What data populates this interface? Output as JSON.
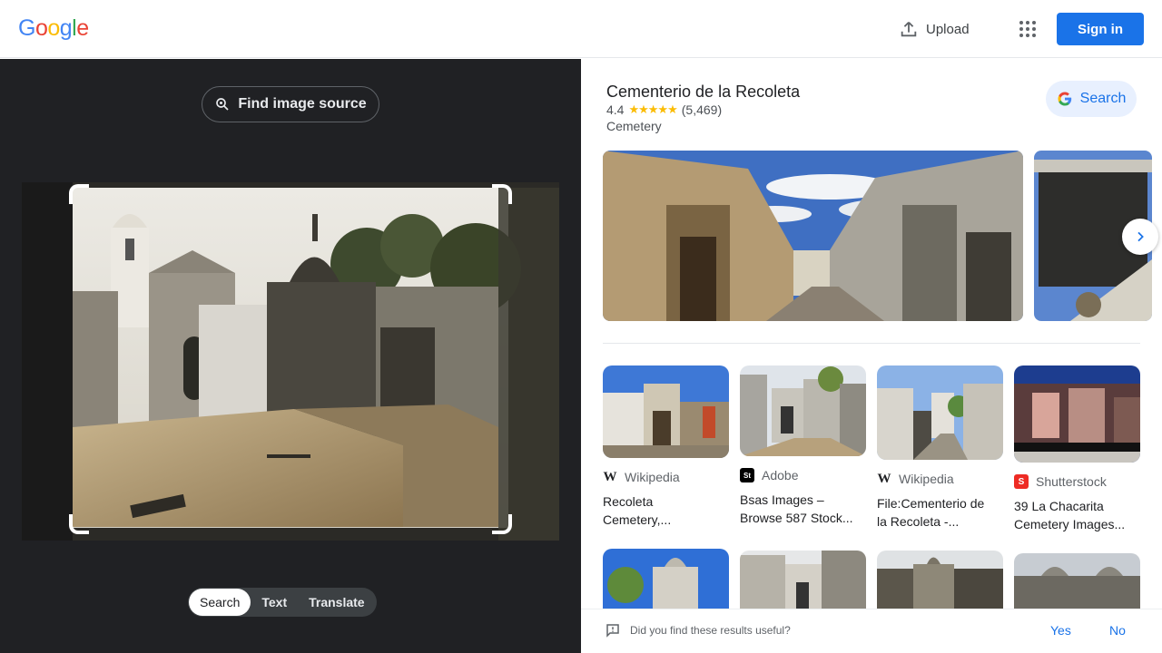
{
  "header": {
    "logo_letters": [
      "G",
      "o",
      "o",
      "g",
      "l",
      "e"
    ],
    "logo_colors": [
      "#4285F4",
      "#EA4335",
      "#FBBC05",
      "#4285F4",
      "#34A853",
      "#EA4335"
    ],
    "upload_label": "Upload",
    "signin_label": "Sign in"
  },
  "left": {
    "find_source_label": "Find image source",
    "tabs": [
      {
        "label": "Search",
        "active": true
      },
      {
        "label": "Text",
        "active": false
      },
      {
        "label": "Translate",
        "active": false
      }
    ]
  },
  "knowledge_panel": {
    "title": "Cementerio de la Recoleta",
    "rating": "4.4",
    "stars": "★★★★★",
    "review_count": "(5,469)",
    "type": "Cemetery",
    "search_label": "Search"
  },
  "results": [
    {
      "source": "Wikipedia",
      "favicon": "W",
      "caption_1": "Recoleta",
      "caption_2": "Cemetery,..."
    },
    {
      "source": "Adobe",
      "favicon": "St",
      "caption_1": "Bsas Images –",
      "caption_2": "Browse 587 Stock..."
    },
    {
      "source": "Wikipedia",
      "favicon": "W",
      "caption_1": "File:Cementerio de",
      "caption_2": "la Recoleta -..."
    },
    {
      "source": "Shutterstock",
      "favicon": "S",
      "caption_1": "39 La Chacarita",
      "caption_2": "Cemetery Images..."
    }
  ],
  "feedback": {
    "question": "Did you find these results useful?",
    "yes_label": "Yes",
    "no_label": "No"
  },
  "colors": {
    "brand_blue": "#1a73e8",
    "dark_bg": "#202124",
    "star_yellow": "#fbbc04"
  }
}
